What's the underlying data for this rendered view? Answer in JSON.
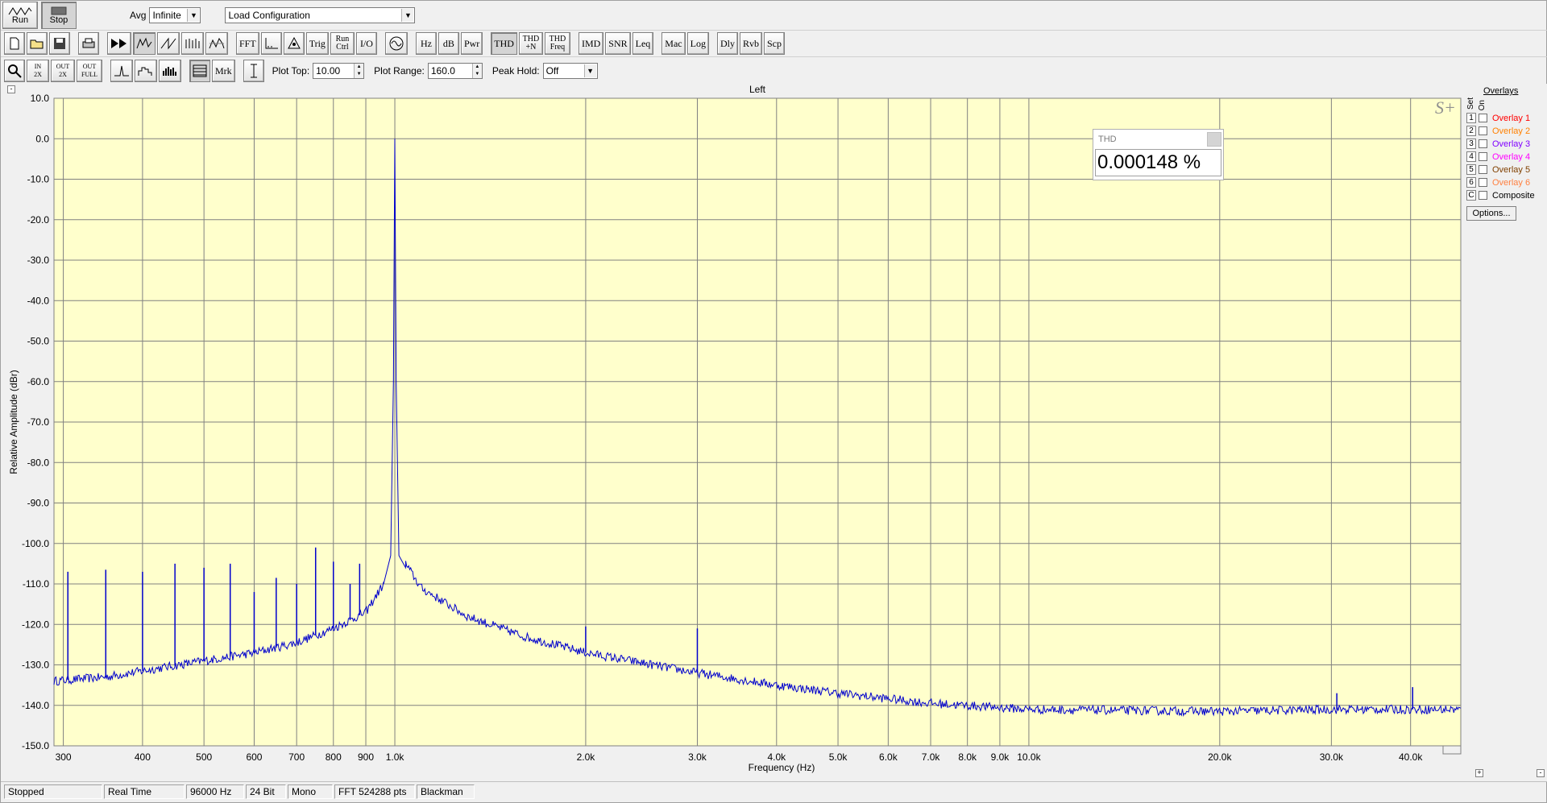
{
  "toolbar": {
    "run_label": "Run",
    "stop_label": "Stop",
    "avg_label": "Avg",
    "avg_value": "Infinite",
    "config_value": "Load Configuration",
    "buttons_row2": [
      "FFT",
      "Trig",
      "Run Ctrl",
      "I/O",
      "Hz",
      "dB",
      "Pwr",
      "THD",
      "THD +N",
      "THD Freq",
      "IMD",
      "SNR",
      "Leq",
      "Mac",
      "Log",
      "Dly",
      "Rvb",
      "Scp"
    ],
    "mrk_label": "Mrk",
    "plot_top_label": "Plot Top:",
    "plot_top_value": "10.00",
    "plot_range_label": "Plot Range:",
    "plot_range_value": "160.0",
    "peak_hold_label": "Peak Hold:",
    "peak_hold_value": "Off",
    "in_2x": "IN 2X",
    "out_2x": "OUT 2X",
    "out_full": "OUT FULL"
  },
  "plot": {
    "title": "Left",
    "logo": "S+",
    "thd_label": "THD",
    "thd_value": "0.000148 %"
  },
  "overlays": {
    "title": "Overlays",
    "set_label": "Set",
    "on_label": "On",
    "items": [
      {
        "num": "1",
        "label": "Overlay 1",
        "color": "#ff0000"
      },
      {
        "num": "2",
        "label": "Overlay 2",
        "color": "#ff8000"
      },
      {
        "num": "3",
        "label": "Overlay 3",
        "color": "#8000ff"
      },
      {
        "num": "4",
        "label": "Overlay 4",
        "color": "#ff00ff"
      },
      {
        "num": "5",
        "label": "Overlay 5",
        "color": "#804000"
      },
      {
        "num": "6",
        "label": "Overlay 6",
        "color": "#ff8040"
      },
      {
        "num": "C",
        "label": "Composite",
        "color": "#000000"
      }
    ],
    "options_label": "Options..."
  },
  "status": {
    "state": "Stopped",
    "mode": "Real Time",
    "rate": "96000 Hz",
    "bits": "24 Bit",
    "channels": "Mono",
    "fft": "FFT 524288 pts",
    "window": "Blackman"
  },
  "chart_data": {
    "type": "line",
    "title": "Left",
    "xlabel": "Frequency (Hz)",
    "ylabel": "Relative Amplitude (dBr)",
    "xscale": "log",
    "xlim": [
      290,
      48000
    ],
    "ylim": [
      -150,
      10
    ],
    "grid": true,
    "background": "#ffffcc",
    "line_color": "#0000cc",
    "x_ticks": [
      300,
      400,
      500,
      600,
      700,
      800,
      900,
      1000,
      2000,
      3000,
      4000,
      5000,
      6000,
      7000,
      8000,
      9000,
      10000,
      20000,
      30000,
      40000
    ],
    "x_tick_labels": [
      "300",
      "400",
      "500",
      "600",
      "700",
      "800",
      "900",
      "1.0k",
      "2.0k",
      "3.0k",
      "4.0k",
      "5.0k",
      "6.0k",
      "7.0k",
      "8.0k",
      "9.0k",
      "10.0k",
      "20.0k",
      "30.0k",
      "40.0k"
    ],
    "y_ticks": [
      10,
      0,
      -10,
      -20,
      -30,
      -40,
      -50,
      -60,
      -70,
      -80,
      -90,
      -100,
      -110,
      -120,
      -130,
      -140,
      -150
    ],
    "y_tick_labels": [
      "10.0",
      "0.0",
      "-10.0",
      "-20.0",
      "-30.0",
      "-40.0",
      "-50.0",
      "-60.0",
      "-70.0",
      "-80.0",
      "-90.0",
      "-100.0",
      "-110.0",
      "-120.0",
      "-130.0",
      "-140.0",
      "-150.0"
    ],
    "noise_floor": [
      [
        290,
        -134
      ],
      [
        350,
        -133
      ],
      [
        400,
        -131.5
      ],
      [
        500,
        -129
      ],
      [
        600,
        -127
      ],
      [
        700,
        -124.5
      ],
      [
        800,
        -121
      ],
      [
        900,
        -117
      ],
      [
        960,
        -110
      ],
      [
        990,
        -100
      ],
      [
        1000,
        0
      ],
      [
        1010,
        -100
      ],
      [
        1040,
        -105
      ],
      [
        1100,
        -111
      ],
      [
        1300,
        -118
      ],
      [
        1600,
        -123
      ],
      [
        2000,
        -127
      ],
      [
        3000,
        -132
      ],
      [
        4000,
        -135
      ],
      [
        5000,
        -137
      ],
      [
        7000,
        -139.5
      ],
      [
        10000,
        -141
      ],
      [
        20000,
        -141.5
      ],
      [
        30000,
        -141
      ],
      [
        40000,
        -141
      ],
      [
        48000,
        -141
      ]
    ],
    "spikes": [
      [
        305,
        -107
      ],
      [
        350,
        -106.5
      ],
      [
        400,
        -107
      ],
      [
        450,
        -105
      ],
      [
        500,
        -106
      ],
      [
        550,
        -105
      ],
      [
        600,
        -112
      ],
      [
        650,
        -108.5
      ],
      [
        700,
        -110
      ],
      [
        750,
        -101
      ],
      [
        800,
        -104.5
      ],
      [
        850,
        -110
      ],
      [
        880,
        -105
      ],
      [
        1000,
        0
      ],
      [
        2000,
        -120.5
      ],
      [
        3000,
        -121
      ],
      [
        30600,
        -137
      ],
      [
        40300,
        -135.5
      ]
    ]
  }
}
